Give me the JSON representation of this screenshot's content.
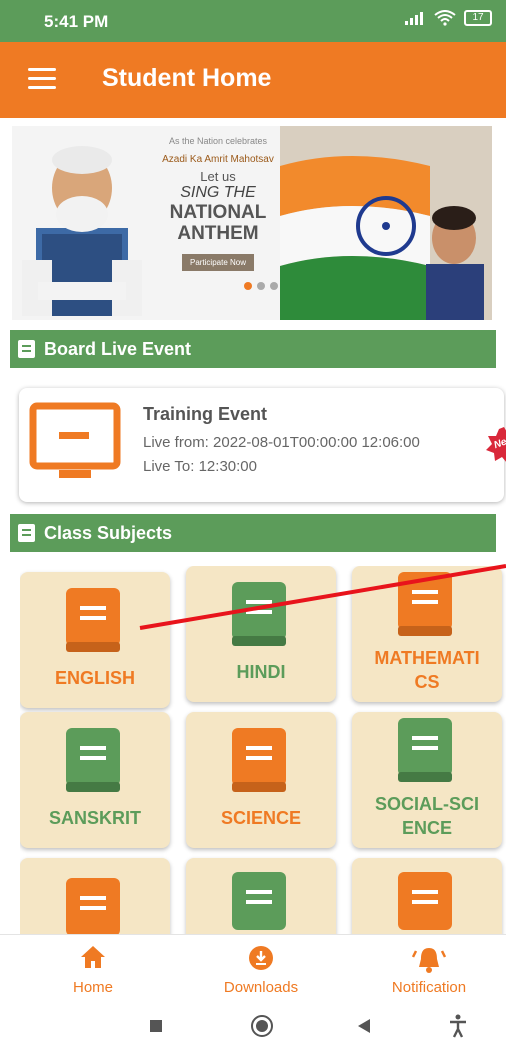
{
  "status_bar": {
    "time": "5:41 PM",
    "battery": "17"
  },
  "app_bar": {
    "title": "Student Home"
  },
  "banner": {
    "line1": "As the Nation celebrates",
    "line2": "Azadi Ka Amrit Mahotsav",
    "line3": "Let us",
    "line4": "SING THE",
    "line5": "NATIONAL ANTHEM",
    "button": "Participate Now"
  },
  "live_section": {
    "title": "Board Live Event"
  },
  "event": {
    "title": "Training Event",
    "live_from": "Live from: 2022-08-01T00:00:00 12:06:00",
    "live_to": "Live To: 12:30:00",
    "badge": "New"
  },
  "subjects_section": {
    "title": "Class Subjects"
  },
  "subjects": [
    {
      "name": "ENGLISH",
      "color": "#ef7a23"
    },
    {
      "name": "HINDI",
      "color": "#5c9c5a"
    },
    {
      "name": "MATHEMATI CS",
      "color": "#ef7a23"
    },
    {
      "name": "SANSKRIT",
      "color": "#5c9c5a"
    },
    {
      "name": "SCIENCE",
      "color": "#ef7a23"
    },
    {
      "name": "SOCIAL-SCI ENCE",
      "color": "#5c9c5a"
    }
  ],
  "bottom_nav": {
    "home": "Home",
    "downloads": "Downloads",
    "notification": "Notification"
  },
  "colors": {
    "green": "#5c9c5a",
    "orange": "#ef7a23",
    "card": "#f5e6c5"
  }
}
